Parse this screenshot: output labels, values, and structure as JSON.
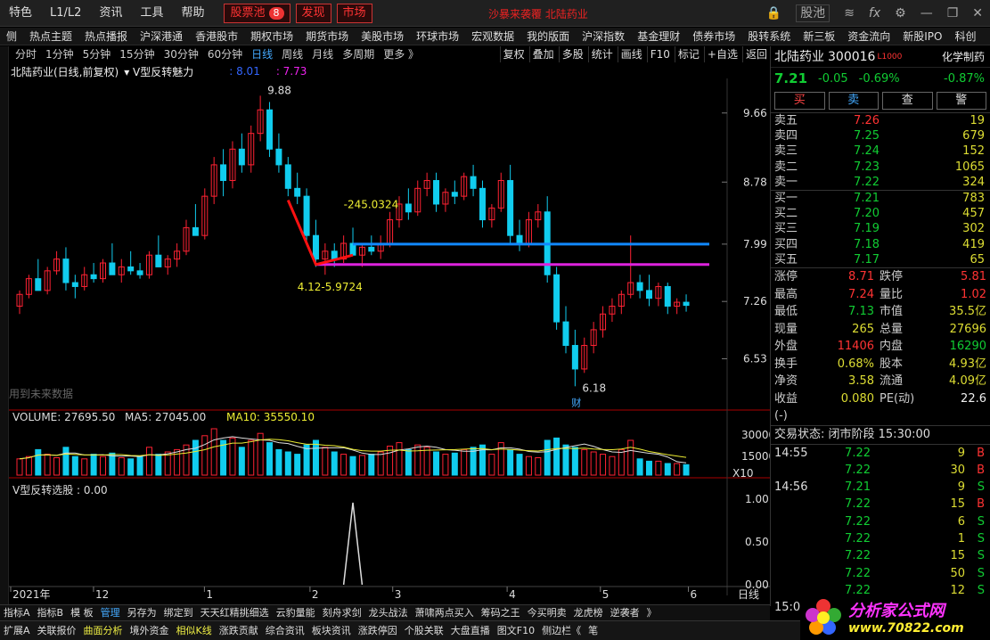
{
  "topbar": {
    "menus": [
      "特色",
      "L1/L2",
      "资讯",
      "工具",
      "帮助"
    ],
    "tabs": [
      {
        "label": "股票池",
        "badge": "8"
      },
      {
        "label": "发现"
      },
      {
        "label": "市场"
      }
    ],
    "notice": "沙暴来袭覆  北陆药业",
    "pool_label": "股池",
    "icons": [
      "layers-icon",
      "fx-icon",
      "gear-icon",
      "minimize-icon",
      "restore-icon",
      "close-icon"
    ]
  },
  "nav": [
    "侧",
    "热点主题",
    "热点播报",
    "沪深港通",
    "香港股市",
    "期权市场",
    "期货市场",
    "美股市场",
    "环球市场",
    "宏观数据",
    "我的版面",
    "沪深指数",
    "基金理财",
    "债券市场",
    "股转系统",
    "新三板",
    "资金流向",
    "新股IPO",
    "科创"
  ],
  "periods": [
    "分时",
    "1分钟",
    "5分钟",
    "15分钟",
    "30分钟",
    "60分钟",
    "日线",
    "周线",
    "月线",
    "多周期",
    "更多 》"
  ],
  "tools": [
    "复权",
    "叠加",
    "多股",
    "统计",
    "画线",
    "F10",
    "标记",
    "+自选",
    "返回"
  ],
  "info": {
    "title": "北陆药业(日线,前复权)",
    "indicator": "V型反转魅力",
    "v1_label": ": 8.01",
    "v2_label": ": 7.73"
  },
  "chart_data": {
    "type": "candlestick",
    "ylim": [
      5.9,
      10.1
    ],
    "y_ticks": [
      9.66,
      8.78,
      7.99,
      7.26,
      6.53
    ],
    "x_labels": [
      "2021年",
      "12",
      "1",
      "2",
      "3",
      "4",
      "5",
      "6"
    ],
    "x_label_pos": [
      0,
      42,
      105,
      165,
      212,
      277,
      330,
      380
    ],
    "n": 384,
    "candles": [
      [
        7.2,
        7.4,
        7.1,
        7.35
      ],
      [
        7.35,
        7.6,
        7.3,
        7.55
      ],
      [
        7.55,
        7.8,
        7.5,
        7.4
      ],
      [
        7.4,
        7.7,
        7.35,
        7.65
      ],
      [
        7.65,
        7.9,
        7.6,
        7.8
      ],
      [
        7.8,
        7.95,
        7.4,
        7.5
      ],
      [
        7.5,
        7.6,
        7.3,
        7.45
      ],
      [
        7.45,
        7.7,
        7.4,
        7.6
      ],
      [
        7.6,
        7.75,
        7.5,
        7.55
      ],
      [
        7.55,
        7.8,
        7.5,
        7.75
      ],
      [
        7.75,
        8.0,
        7.7,
        7.6
      ],
      [
        7.6,
        7.8,
        7.5,
        7.7
      ],
      [
        7.7,
        7.9,
        7.6,
        7.65
      ],
      [
        7.65,
        7.75,
        7.55,
        7.6
      ],
      [
        7.6,
        7.9,
        7.55,
        7.85
      ],
      [
        7.85,
        8.1,
        7.8,
        7.7
      ],
      [
        7.7,
        7.85,
        7.6,
        7.8
      ],
      [
        7.8,
        8.0,
        7.7,
        7.9
      ],
      [
        7.9,
        8.3,
        7.85,
        8.2
      ],
      [
        8.2,
        8.5,
        8.1,
        8.1
      ],
      [
        8.1,
        8.7,
        8.05,
        8.6
      ],
      [
        8.6,
        9.1,
        8.5,
        9.0
      ],
      [
        9.0,
        9.2,
        8.6,
        8.8
      ],
      [
        8.8,
        9.3,
        8.7,
        9.2
      ],
      [
        9.2,
        9.4,
        8.9,
        9.0
      ],
      [
        9.0,
        9.5,
        8.9,
        9.4
      ],
      [
        9.4,
        9.88,
        9.3,
        9.7
      ],
      [
        9.7,
        9.8,
        9.1,
        9.2
      ],
      [
        9.2,
        9.4,
        8.9,
        9.0
      ],
      [
        9.0,
        9.1,
        8.6,
        8.7
      ],
      [
        8.7,
        8.9,
        8.5,
        8.6
      ],
      [
        8.6,
        8.7,
        8.0,
        8.1
      ],
      [
        8.1,
        8.3,
        7.7,
        7.8
      ],
      [
        7.8,
        8.0,
        7.6,
        7.9
      ],
      [
        7.9,
        8.0,
        7.7,
        7.8
      ],
      [
        7.8,
        8.1,
        7.75,
        8.0
      ],
      [
        8.0,
        8.2,
        7.9,
        7.85
      ],
      [
        7.85,
        8.0,
        7.7,
        7.95
      ],
      [
        7.95,
        8.1,
        7.85,
        7.9
      ],
      [
        7.9,
        8.1,
        7.8,
        8.0
      ],
      [
        8.0,
        8.4,
        7.95,
        8.3
      ],
      [
        8.3,
        8.6,
        8.2,
        8.5
      ],
      [
        8.5,
        8.7,
        8.3,
        8.4
      ],
      [
        8.4,
        8.8,
        8.35,
        8.7
      ],
      [
        8.7,
        8.9,
        8.6,
        8.8
      ],
      [
        8.8,
        8.9,
        8.4,
        8.5
      ],
      [
        8.5,
        8.7,
        8.4,
        8.65
      ],
      [
        8.65,
        8.8,
        8.5,
        8.6
      ],
      [
        8.6,
        8.9,
        8.55,
        8.85
      ],
      [
        8.85,
        9.0,
        8.6,
        8.7
      ],
      [
        8.7,
        8.8,
        8.2,
        8.3
      ],
      [
        8.3,
        8.5,
        8.2,
        8.45
      ],
      [
        8.45,
        8.9,
        8.4,
        8.8
      ],
      [
        8.8,
        9.0,
        8.0,
        8.1
      ],
      [
        8.1,
        8.3,
        7.9,
        8.0
      ],
      [
        8.0,
        8.4,
        7.95,
        8.3
      ],
      [
        8.3,
        8.5,
        8.2,
        8.4
      ],
      [
        8.4,
        8.6,
        7.5,
        7.6
      ],
      [
        7.6,
        7.7,
        6.9,
        7.0
      ],
      [
        7.0,
        7.2,
        6.6,
        6.7
      ],
      [
        6.7,
        6.9,
        6.18,
        6.4
      ],
      [
        6.4,
        6.8,
        6.35,
        6.7
      ],
      [
        6.7,
        7.0,
        6.6,
        6.9
      ],
      [
        6.9,
        7.2,
        6.8,
        7.1
      ],
      [
        7.1,
        7.3,
        7.0,
        7.2
      ],
      [
        7.2,
        7.4,
        7.1,
        7.35
      ],
      [
        7.35,
        8.1,
        7.3,
        7.5
      ],
      [
        7.5,
        7.6,
        7.3,
        7.4
      ],
      [
        7.4,
        7.6,
        7.2,
        7.3
      ],
      [
        7.3,
        7.5,
        7.2,
        7.45
      ],
      [
        7.45,
        7.5,
        7.1,
        7.2
      ],
      [
        7.2,
        7.3,
        7.1,
        7.25
      ],
      [
        7.25,
        7.35,
        7.13,
        7.21
      ]
    ],
    "volume_label": "VOLUME: 27695.50",
    "ma5_label": "MA5: 27045.00",
    "ma10_label": "MA10: 35550.10",
    "vol_ticks": [
      "30000",
      "15000",
      "X10"
    ],
    "vol": [
      14,
      16,
      22,
      18,
      15,
      24,
      16,
      14,
      18,
      16,
      19,
      15,
      14,
      16,
      24,
      18,
      20,
      22,
      26,
      30,
      34,
      40,
      30,
      32,
      24,
      30,
      36,
      28,
      22,
      20,
      18,
      26,
      30,
      24,
      20,
      18,
      16,
      17,
      18,
      20,
      25,
      28,
      22,
      26,
      24,
      20,
      18,
      19,
      22,
      24,
      26,
      18,
      28,
      22,
      18,
      16,
      15,
      30,
      32,
      26,
      24,
      22,
      20,
      18,
      16,
      22,
      30,
      14,
      12,
      12,
      10,
      10,
      9
    ],
    "sub_label": "V型反转选股 : 0.00",
    "sub_ticks": [
      "1.00",
      "0.50",
      "0.00"
    ],
    "annotations": {
      "high": "9.88",
      "low": "6.18",
      "mid": "-245.0324",
      "fib": "4.12-5.9724",
      "future": "用到未来数据",
      "cai": "财",
      "dayline": "日线"
    }
  },
  "quote": {
    "name": "北陆药业",
    "code": "300016",
    "flag": "L1000",
    "sector": "化学制药",
    "price": "7.21",
    "chg": "-0.05",
    "pct": "-0.69%",
    "sector_pct": "-0.87%",
    "buttons": [
      "买",
      "卖",
      "查",
      "警"
    ],
    "asks": [
      {
        "l": "卖五",
        "p": "7.26",
        "v": "19"
      },
      {
        "l": "卖四",
        "p": "7.25",
        "v": "679"
      },
      {
        "l": "卖三",
        "p": "7.24",
        "v": "152"
      },
      {
        "l": "卖二",
        "p": "7.23",
        "v": "1065"
      },
      {
        "l": "卖一",
        "p": "7.22",
        "v": "324"
      }
    ],
    "bids": [
      {
        "l": "买一",
        "p": "7.21",
        "v": "783"
      },
      {
        "l": "买二",
        "p": "7.20",
        "v": "457"
      },
      {
        "l": "买三",
        "p": "7.19",
        "v": "302"
      },
      {
        "l": "买四",
        "p": "7.18",
        "v": "419"
      },
      {
        "l": "买五",
        "p": "7.17",
        "v": "65"
      }
    ],
    "stats": [
      [
        "涨停",
        "8.71",
        "跌停",
        "5.81"
      ],
      [
        "最高",
        "7.24",
        "量比",
        "1.02"
      ],
      [
        "最低",
        "7.13",
        "市值",
        "35.5亿"
      ],
      [
        "现量",
        "265",
        "总量",
        "27696"
      ],
      [
        "外盘",
        "11406",
        "内盘",
        "16290"
      ],
      [
        "换手",
        "0.68%",
        "股本",
        "4.93亿"
      ],
      [
        "净资",
        "3.58",
        "流通",
        "4.09亿"
      ],
      [
        "收益(-)",
        "0.080",
        "PE(动)",
        "22.6"
      ]
    ],
    "trade_state": "交易状态: 闭市阶段 15:30:00",
    "ticks": [
      [
        "14:55",
        "7.22",
        "9",
        "B"
      ],
      [
        "",
        "7.22",
        "30",
        "B"
      ],
      [
        "14:56",
        "7.21",
        "9",
        "S"
      ],
      [
        "",
        "7.22",
        "15",
        "B"
      ],
      [
        "",
        "7.22",
        "6",
        "S"
      ],
      [
        "",
        "7.22",
        "1",
        "S"
      ],
      [
        "",
        "7.22",
        "15",
        "S"
      ],
      [
        "",
        "7.22",
        "50",
        "S"
      ],
      [
        "",
        "7.22",
        "12",
        "S"
      ],
      [
        "15:00",
        "",
        "",
        ""
      ]
    ]
  },
  "bottomtabs": [
    "指标A",
    "指标B",
    "模 板",
    "管理",
    "另存为",
    "绑定到",
    "天天红精挑细选",
    "云豹量能",
    "刻舟求剑",
    "龙头战法",
    "萧啸两点买入",
    "筹码之王",
    "今买明卖",
    "龙虎榜",
    "逆袭者",
    "》"
  ],
  "statusbar": [
    "扩展A",
    "关联报价",
    "曲面分析",
    "境外资金",
    "相似K线",
    "涨跌贡献",
    "综合资讯",
    "板块资讯",
    "涨跌停因",
    "个股关联",
    "大盘直播",
    "图文F10",
    "侧边栏《",
    "笔"
  ],
  "logo": {
    "text": "分析家公式网",
    "url": "www.70822.com"
  }
}
